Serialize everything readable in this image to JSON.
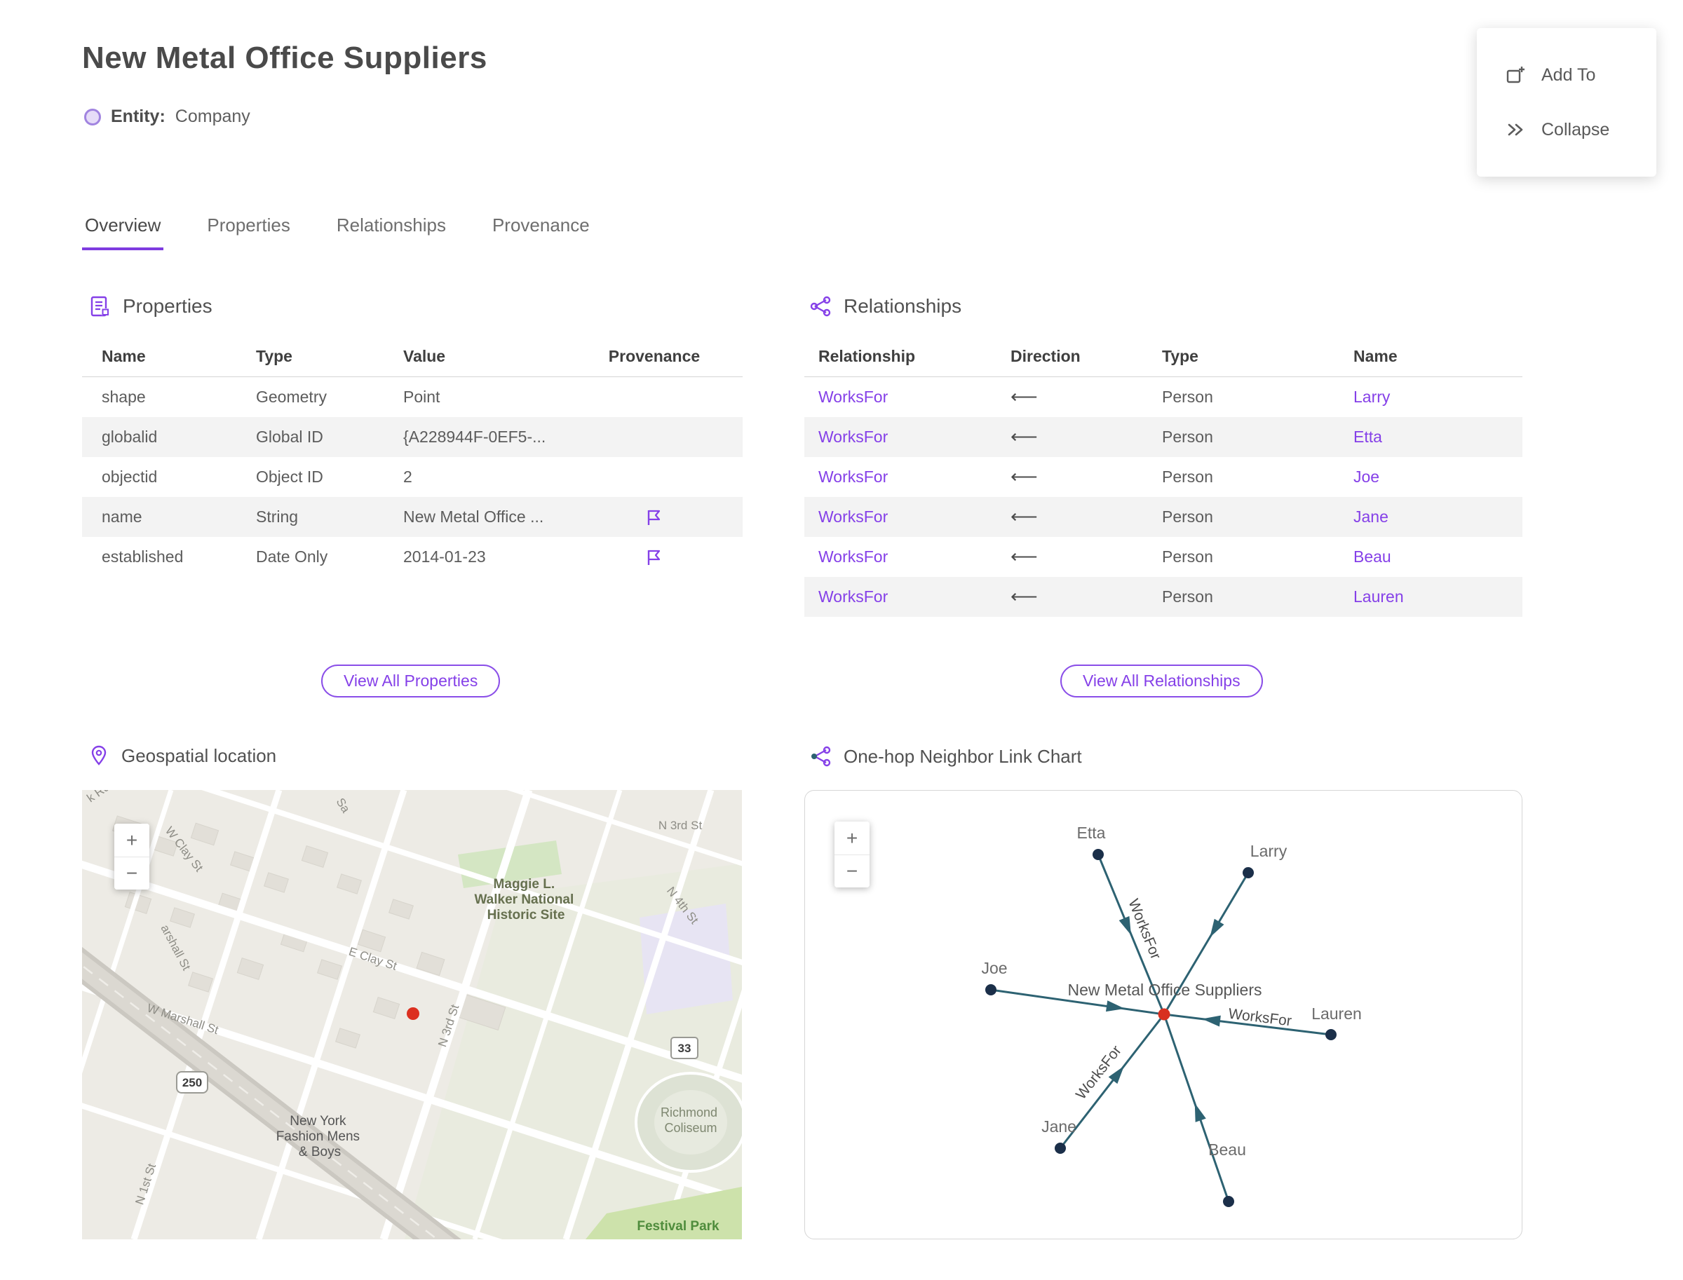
{
  "header": {
    "title": "New Metal Office Suppliers",
    "entity_label": "Entity:",
    "entity_value": "Company"
  },
  "action_panel": {
    "add_to": "Add To",
    "collapse": "Collapse"
  },
  "tabs": {
    "overview": "Overview",
    "properties": "Properties",
    "relationships": "Relationships",
    "provenance": "Provenance"
  },
  "properties": {
    "section_title": "Properties",
    "columns": {
      "name": "Name",
      "type": "Type",
      "value": "Value",
      "provenance": "Provenance"
    },
    "rows": [
      {
        "name": "shape",
        "type": "Geometry",
        "value": "Point"
      },
      {
        "name": "globalid",
        "type": "Global ID",
        "value": "{A228944F-0EF5-..."
      },
      {
        "name": "objectid",
        "type": "Object ID",
        "value": "2"
      },
      {
        "name": "name",
        "type": "String",
        "value": "New Metal Office ..."
      },
      {
        "name": "established",
        "type": "Date Only",
        "value": "2014-01-23"
      }
    ],
    "view_all": "View All Properties"
  },
  "relationships": {
    "section_title": "Relationships",
    "columns": {
      "relationship": "Relationship",
      "direction": "Direction",
      "type": "Type",
      "name": "Name"
    },
    "direction_arrow": "⟵",
    "rows": [
      {
        "relationship": "WorksFor",
        "type": "Person",
        "name": "Larry"
      },
      {
        "relationship": "WorksFor",
        "type": "Person",
        "name": "Etta"
      },
      {
        "relationship": "WorksFor",
        "type": "Person",
        "name": "Joe"
      },
      {
        "relationship": "WorksFor",
        "type": "Person",
        "name": "Jane"
      },
      {
        "relationship": "WorksFor",
        "type": "Person",
        "name": "Beau"
      },
      {
        "relationship": "WorksFor",
        "type": "Person",
        "name": "Lauren"
      }
    ],
    "view_all": "View All Relationships"
  },
  "map": {
    "section_title": "Geospatial location",
    "zoom_in": "+",
    "zoom_out": "−",
    "labels": {
      "k_rd": "k Rd",
      "sa": "Sa",
      "w_clay": "W Clay St",
      "n3rd_top": "N 3rd St",
      "maggie": [
        "Maggie L.",
        "Walker National",
        "Historic Site"
      ],
      "n4th": "N 4th St",
      "marshall_partial": "arshall St",
      "e_clay": "E Clay St",
      "w_marshall": "W Marshall St",
      "n3rd_mid": "N 3rd St",
      "route250": "250",
      "route33": "33",
      "ny_fashion": [
        "New York",
        "Fashion Mens",
        "& Boys"
      ],
      "coliseum": [
        "Richmond",
        "Coliseum"
      ],
      "festival": "Festival Park",
      "n1st": "N 1st St"
    }
  },
  "link_chart": {
    "section_title": "One-hop Neighbor Link Chart",
    "zoom_in": "+",
    "zoom_out": "−",
    "center": "New Metal Office Suppliers",
    "edge_label": "WorksFor",
    "nodes": [
      "Etta",
      "Larry",
      "Joe",
      "Lauren",
      "Jane",
      "Beau"
    ]
  },
  "colors": {
    "accent": "#8540E8",
    "graph_edge": "#2D6272",
    "graph_node": "#1B2F49",
    "graph_center": "#D83020"
  }
}
